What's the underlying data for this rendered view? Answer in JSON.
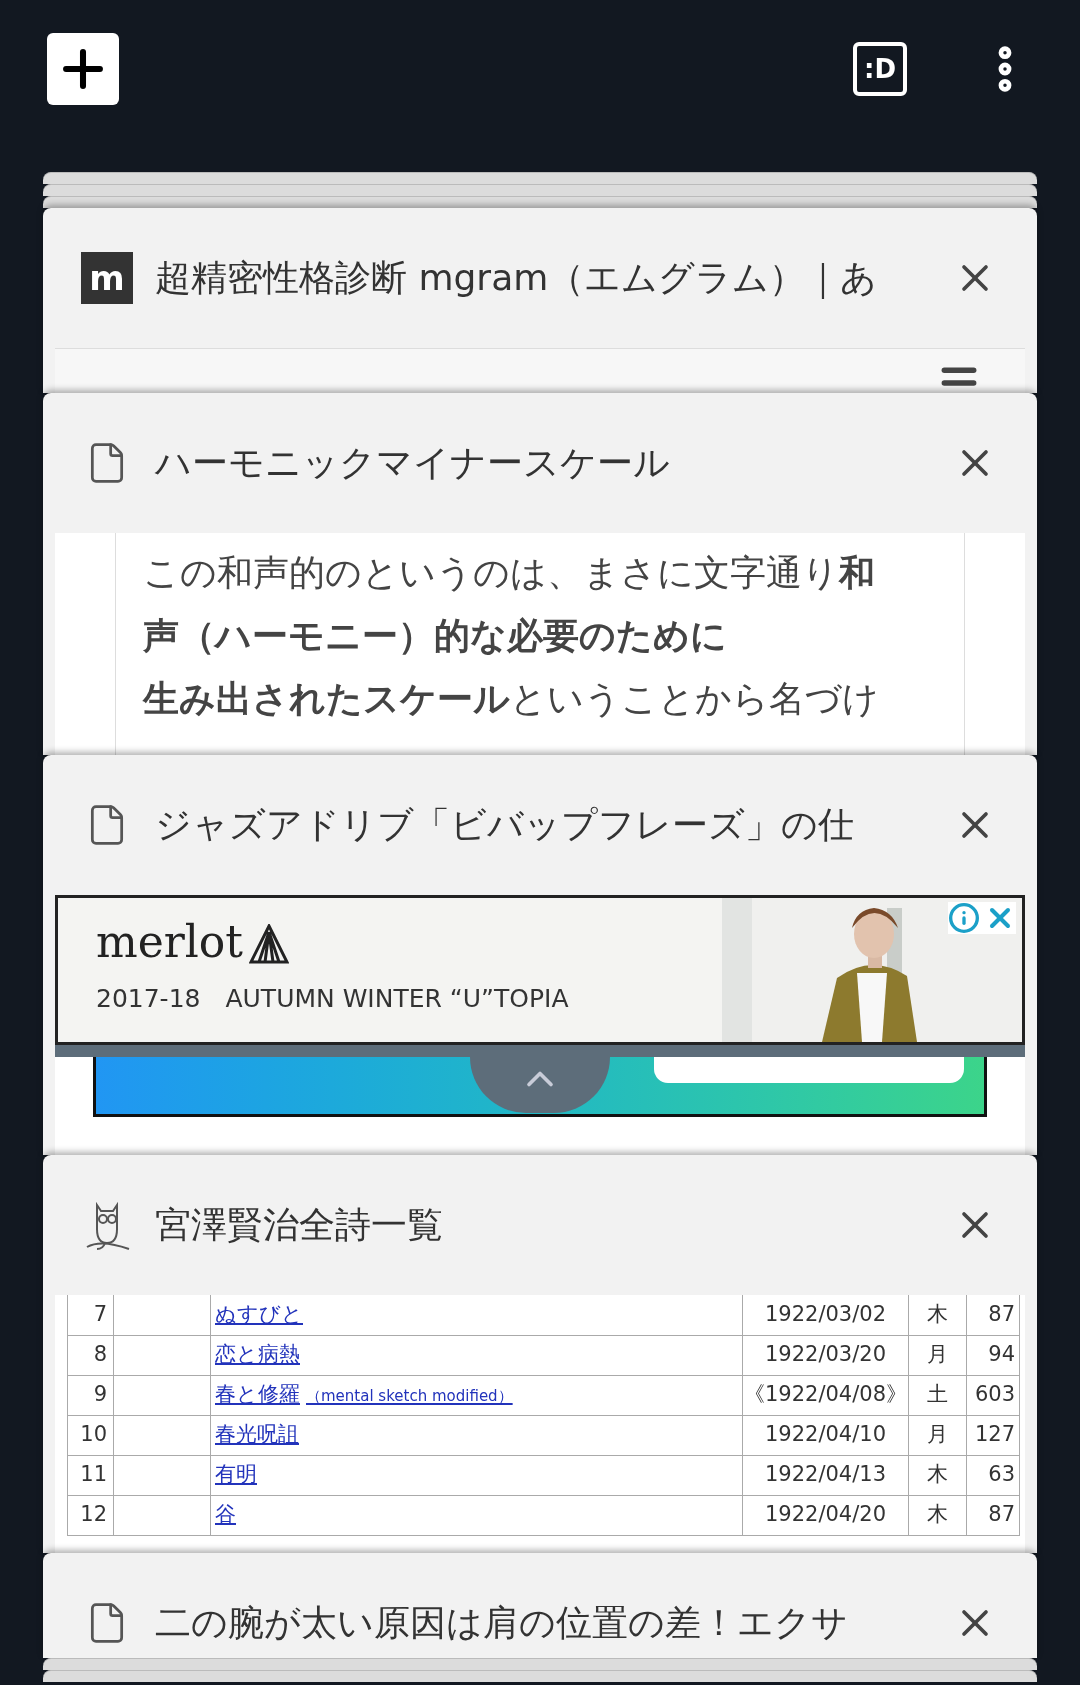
{
  "top_bar": {
    "tab_count": ":D"
  },
  "tabs": [
    {
      "favicon": {
        "kind": "letter",
        "text": "m"
      },
      "title": "超精密性格診断 mgram（エムグラム）｜あ",
      "preview": {
        "kind": "site_header"
      }
    },
    {
      "favicon": {
        "kind": "page"
      },
      "title": "ハーモニックマイナースケール",
      "preview": {
        "kind": "paragraph",
        "lines": [
          "この和声的のというのは、まさに文字通り**和**",
          "**声（ハーモニー）的な必要のために**",
          "**生み出されたスケール**ということから名づけ"
        ]
      }
    },
    {
      "favicon": {
        "kind": "page"
      },
      "title": "ジャズアドリブ「ビバップフレーズ」の仕",
      "preview": {
        "kind": "ad",
        "brand": "merlot",
        "tagline": "2017-18　AUTUMN WINTER “U”TOPIA"
      }
    },
    {
      "favicon": {
        "kind": "owl"
      },
      "title": "宮澤賢治全詩一覧",
      "preview": {
        "kind": "table",
        "rows": [
          {
            "number": "7",
            "title": "ぬすびと",
            "date": "1922/03/02",
            "weekday": "木",
            "count": "87"
          },
          {
            "number": "8",
            "title": "恋と病熱",
            "date": "1922/03/20",
            "weekday": "月",
            "count": "94"
          },
          {
            "number": "9",
            "title": "春と修羅",
            "note": "（mental sketch modified）",
            "date": "《1922/04/08》",
            "weekday": "土",
            "count": "603"
          },
          {
            "number": "10",
            "title": "春光呪詛",
            "date": "1922/04/10",
            "weekday": "月",
            "count": "127"
          },
          {
            "number": "11",
            "title": "有明",
            "date": "1922/04/13",
            "weekday": "木",
            "count": "63"
          },
          {
            "number": "12",
            "title": "谷",
            "date": "1922/04/20",
            "weekday": "木",
            "count": "87"
          }
        ]
      }
    },
    {
      "favicon": {
        "kind": "page"
      },
      "title": "二の腕が太い原因は肩の位置の差！エクサ"
    }
  ]
}
